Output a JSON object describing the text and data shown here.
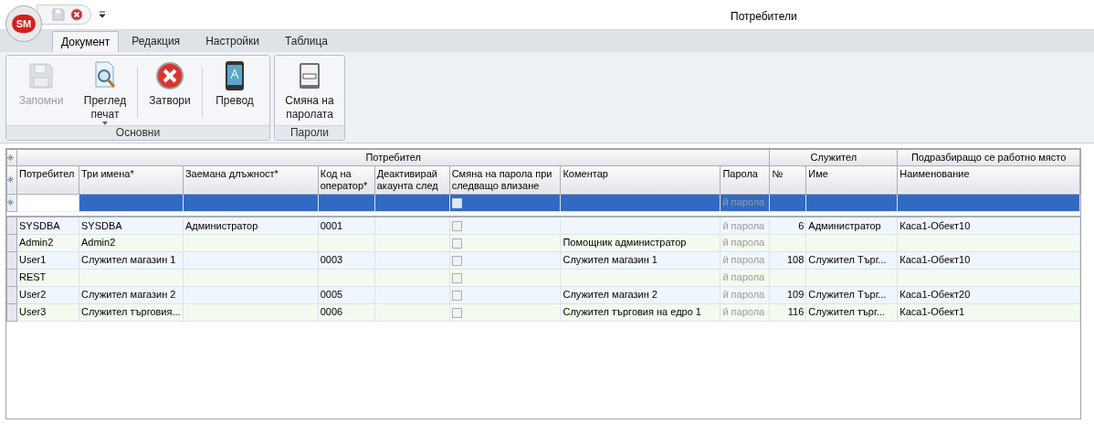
{
  "window": {
    "logo": "SM",
    "title": "Потребители"
  },
  "ribbon": {
    "tabs": [
      {
        "label": "Документ",
        "selected": true
      },
      {
        "label": "Редакция",
        "selected": false
      },
      {
        "label": "Настройки",
        "selected": false
      },
      {
        "label": "Таблица",
        "selected": false
      }
    ],
    "groups": [
      {
        "label": "Основни",
        "buttons": [
          {
            "kind": "save",
            "label": "Запомни",
            "disabled": true
          },
          {
            "kind": "preview",
            "label": "Преглед печат",
            "dropdown": true,
            "disabled": false
          },
          {
            "kind": "close",
            "label": "Затвори",
            "disabled": false
          },
          {
            "kind": "translate",
            "label": "Превод",
            "disabled": false
          }
        ]
      },
      {
        "label": "Пароли",
        "buttons": [
          {
            "kind": "password",
            "label": "Смяна на паролата",
            "disabled": false
          }
        ]
      }
    ]
  },
  "table": {
    "column_groups": [
      {
        "label": "Потребител",
        "columns": [
          {
            "label": "Потребител"
          },
          {
            "label": "Три имена*"
          },
          {
            "label": "Заемана длъжност*"
          },
          {
            "label": "Код на оператор*"
          },
          {
            "label": "Деактивирай акаунта след"
          },
          {
            "label": "Смяна на парола при следващо влизане",
            "kind": "checkbox"
          },
          {
            "label": "Коментар"
          },
          {
            "label": "Парола",
            "kind": "muted"
          }
        ]
      },
      {
        "label": "Служител",
        "columns": [
          {
            "label": "№",
            "kind": "number"
          },
          {
            "label": "Име"
          }
        ]
      },
      {
        "label": "Подразбиращо се работно място",
        "columns": [
          {
            "label": "Наименование"
          }
        ]
      }
    ],
    "new_row": {
      "selected": true,
      "change_password": false,
      "cells": [
        null,
        null,
        null,
        null,
        null,
        null,
        "й парола",
        null,
        null,
        null
      ]
    },
    "rows": [
      {
        "change_password": false,
        "cells": [
          "SYSDBA",
          "SYSDBA",
          "Администратор",
          "0001",
          null,
          null,
          "й парола",
          "6",
          "Администратор",
          "Каса1-Обект10"
        ]
      },
      {
        "change_password": false,
        "cells": [
          "Admin2",
          "Admin2",
          null,
          null,
          null,
          "Помощник администратор",
          "й парола",
          null,
          null,
          null
        ]
      },
      {
        "change_password": false,
        "cells": [
          "User1",
          "Служител магазин 1",
          null,
          "0003",
          null,
          "Служител магазин 1",
          "й парола",
          "108",
          "Служител Търг...",
          "Каса1-Обект10"
        ]
      },
      {
        "change_password": false,
        "cells": [
          "REST",
          null,
          null,
          null,
          null,
          null,
          "й парола",
          null,
          null,
          null
        ]
      },
      {
        "change_password": false,
        "cells": [
          "User2",
          "Служител магазин 2",
          null,
          "0005",
          null,
          "Служител магазин 2",
          "й парола",
          "109",
          "Служител Търг...",
          "Каса1-Обект20"
        ]
      },
      {
        "change_password": false,
        "cells": [
          "User3",
          "Служител търговия...",
          null,
          "0006",
          null,
          "Служител търговия на едро 1",
          "й парола",
          "116",
          "Служител търг...",
          "Каса1-Обект1"
        ]
      }
    ]
  }
}
